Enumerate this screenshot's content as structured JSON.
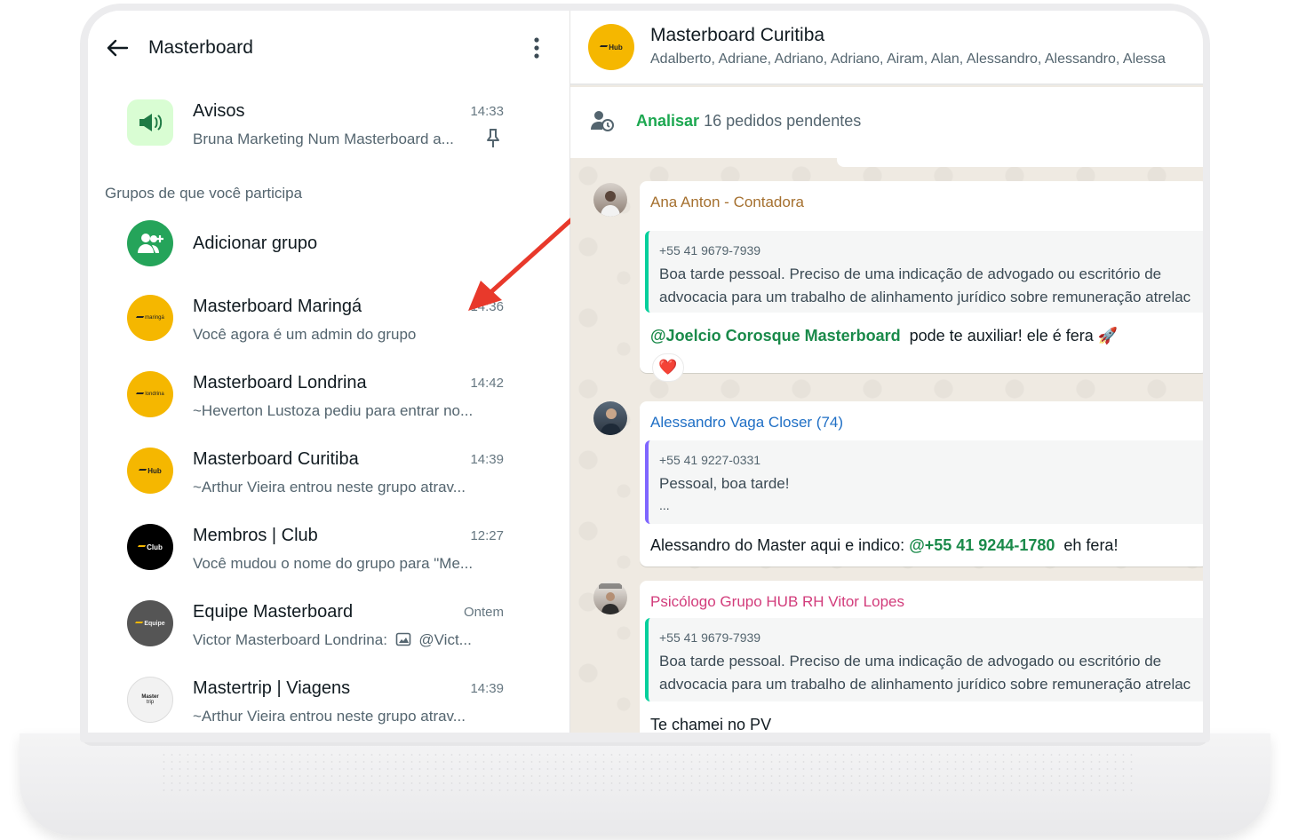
{
  "left": {
    "title": "Masterboard",
    "pinned": {
      "title": "Avisos",
      "time": "14:33",
      "subtitle": "Bruna Marketing Num Masterboard a..."
    },
    "section_label": "Grupos de que você participa",
    "add_group": "Adicionar grupo",
    "groups": [
      {
        "title": "Masterboard Maringá",
        "time": "14:36",
        "subtitle": "Você agora é um admin do grupo",
        "logo": "maringá"
      },
      {
        "title": "Masterboard Londrina",
        "time": "14:42",
        "subtitle": "~Heverton Lustoza pediu para entrar no...",
        "logo": "londrina"
      },
      {
        "title": "Masterboard Curitiba",
        "time": "14:39",
        "subtitle": "~Arthur Vieira entrou neste grupo atrav...",
        "logo": "Hub"
      },
      {
        "title": "Membros | Club",
        "time": "12:27",
        "subtitle": "Você mudou o nome do grupo para \"Me...",
        "logo": "Club"
      },
      {
        "title": "Equipe Masterboard",
        "time": "Ontem",
        "subtitle": "Victor Masterboard Londrina:",
        "subtitle_tail": "@Vict...",
        "logo": "Equipe"
      },
      {
        "title": "Mastertrip | Viagens",
        "time": "14:39",
        "subtitle": "~Arthur Vieira entrou neste grupo atrav...",
        "logo": "Master",
        "logo2": "trip"
      }
    ]
  },
  "right": {
    "header": {
      "title": "Masterboard Curitiba",
      "members": "Adalberto, Adriane, Adriano, Adriano, Airam, Alan, Alessandro, Alessandro, Alessa",
      "logo": "Hub"
    },
    "pending": {
      "link": "Analisar",
      "text": "16 pedidos pendentes"
    },
    "messages": [
      {
        "sender": "Ana Anton - Contadora",
        "sender_color": "#a5702f",
        "quote_phone": "+55 41 9679-7939",
        "quote_line1": "Boa tarde pessoal. Preciso de uma indicação de advogado ou escritório de",
        "quote_line2": "advocacia para um trabalho de alinhamento jurídico sobre remuneração atrelac",
        "mention": "@Joelcio Corosque Masterboard",
        "text": "pode te auxiliar! ele é fera",
        "emoji": "🚀",
        "reaction": "❤️"
      },
      {
        "sender": "Alessandro Vaga Closer (74)",
        "sender_color": "#1f6fc5",
        "quote_phone": "+55 41 9227-0331",
        "quote_line1": "Pessoal, boa tarde!",
        "quote_line2": "...",
        "text_before": "Alessandro do Master aqui e indico:",
        "mention": "@+55 41 9244-1780",
        "text_after": "eh fera!"
      },
      {
        "sender": "Psicólogo Grupo HUB RH Vitor Lopes",
        "sender_color": "#d23c7b",
        "quote_phone": "+55 41 9679-7939",
        "quote_line1": "Boa tarde pessoal. Preciso de uma indicação de advogado ou escritório de",
        "quote_line2": "advocacia para um trabalho de alinhamento jurídico sobre remuneração atrelac",
        "text": "Te chamei no PV"
      }
    ]
  },
  "colors": {
    "accent_green": "#1da851",
    "brand_yellow": "#f5b700",
    "arrow_red": "#e8392b"
  }
}
